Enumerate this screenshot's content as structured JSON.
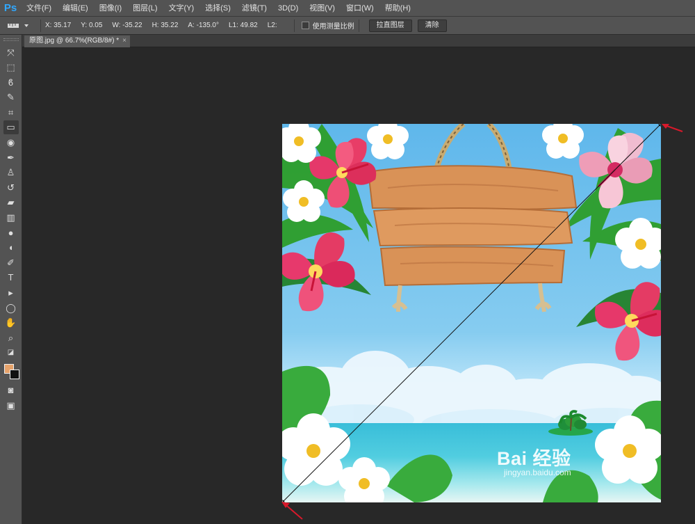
{
  "app": {
    "logo": "Ps",
    "menu": [
      "文件(F)",
      "编辑(E)",
      "图像(I)",
      "图层(L)",
      "文字(Y)",
      "选择(S)",
      "滤镜(T)",
      "3D(D)",
      "视图(V)",
      "窗口(W)",
      "帮助(H)"
    ]
  },
  "options_bar": {
    "x": "X: 35.17",
    "y": "Y: 0.05",
    "w": "W: -35.22",
    "h": "H: 35.22",
    "angle": "A: -135.0°",
    "l1": "L1: 49.82",
    "l2": "L2:",
    "measure_scale_label": "使用测量比例",
    "straighten_layer_label": "拉直图层",
    "clear_label": "清除"
  },
  "document": {
    "tab_title": "原图.jpg @ 66.7%(RGB/8#) *",
    "close": "×"
  },
  "toolbar": {
    "icons": [
      "move-icon",
      "marquee-icon",
      "lasso-icon",
      "quick-selection-icon",
      "crop-icon",
      "ruler-icon",
      "spot-healing-icon",
      "brush-icon",
      "clone-stamp-icon",
      "history-brush-icon",
      "eraser-icon",
      "gradient-icon",
      "blur-icon",
      "dodge-icon",
      "pen-icon",
      "type-icon",
      "path-selection-icon",
      "ellipse-icon",
      "hand-icon",
      "zoom-icon"
    ],
    "active_tool": "ruler-icon",
    "foreground_color": "#e6a26a",
    "background_color": "#111111"
  },
  "canvas": {
    "accent_color": "#d8192b"
  },
  "watermark": {
    "main": "Bai 经验",
    "sub": "jingyan.baidu.com"
  }
}
